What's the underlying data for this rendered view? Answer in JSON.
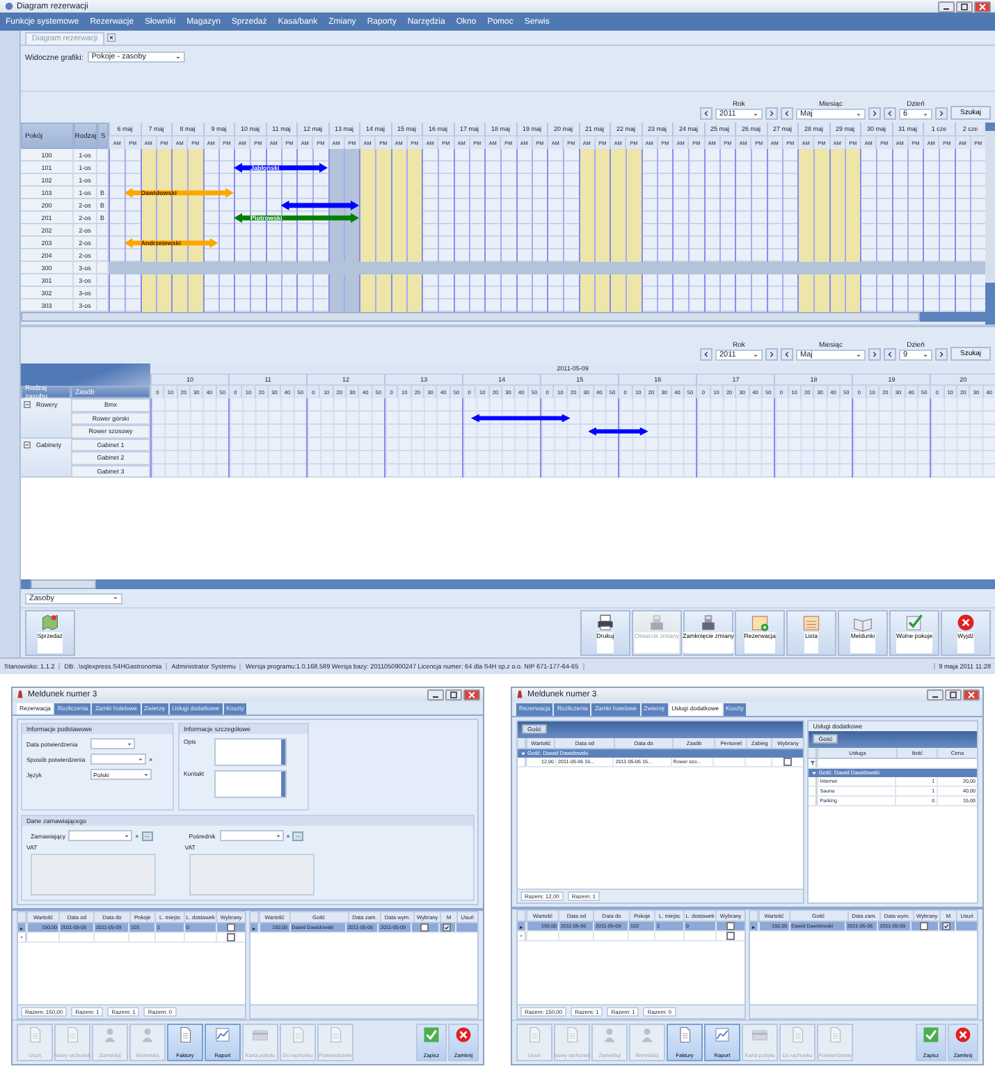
{
  "window": {
    "title": "Diagram rezerwacji"
  },
  "menu": [
    "Funkcje systemowe",
    "Rezerwacje",
    "Słowniki",
    "Magazyn",
    "Sprzedaż",
    "Kasa/bank",
    "Zmiany",
    "Raporty",
    "Narzędzia",
    "Okno",
    "Pomoc",
    "Serwis"
  ],
  "doc_tab": {
    "label": "Diagram rezerwacji",
    "selected": true
  },
  "visible": {
    "label": "Widoczne grafiki:",
    "value": "Pokoje - zasoby"
  },
  "nav_top": {
    "year_label": "Rok",
    "year": "2011",
    "month_label": "Miesiąc",
    "month": "Maj",
    "day_label": "Dzień",
    "day": "6",
    "search": "Szukaj"
  },
  "room_grid": {
    "columns": [
      "Pokój",
      "Rodzaj",
      "S"
    ],
    "days": [
      {
        "label": "6 maj",
        "halves": [
          "AM",
          "PM"
        ],
        "weekend": false,
        "today": false
      },
      {
        "label": "7 maj",
        "halves": [
          "AM",
          "PM"
        ],
        "weekend": true,
        "today": false
      },
      {
        "label": "8 maj",
        "halves": [
          "AM",
          "PM"
        ],
        "weekend": true,
        "today": false
      },
      {
        "label": "9 maj",
        "halves": [
          "AM",
          "PM"
        ],
        "weekend": false,
        "today": false
      },
      {
        "label": "10 maj",
        "halves": [
          "AM",
          "PM"
        ],
        "weekend": false,
        "today": false
      },
      {
        "label": "11 maj",
        "halves": [
          "AM",
          "PM"
        ],
        "weekend": false,
        "today": false
      },
      {
        "label": "12 maj",
        "halves": [
          "AM",
          "PM"
        ],
        "weekend": false,
        "today": false
      },
      {
        "label": "13 maj",
        "halves": [
          "AM",
          "PM"
        ],
        "weekend": false,
        "today": true
      },
      {
        "label": "14 maj",
        "halves": [
          "AM",
          "PM"
        ],
        "weekend": true,
        "today": false
      },
      {
        "label": "15 maj",
        "halves": [
          "AM",
          "PM"
        ],
        "weekend": true,
        "today": false
      },
      {
        "label": "16 maj",
        "halves": [
          "AM",
          "PM"
        ],
        "weekend": false,
        "today": false
      },
      {
        "label": "17 maj",
        "halves": [
          "AM",
          "PM"
        ],
        "weekend": false,
        "today": false
      },
      {
        "label": "18 maj",
        "halves": [
          "AM",
          "PM"
        ],
        "weekend": false,
        "today": false
      },
      {
        "label": "19 maj",
        "halves": [
          "AM",
          "PM"
        ],
        "weekend": false,
        "today": false
      },
      {
        "label": "20 maj",
        "halves": [
          "AM",
          "PM"
        ],
        "weekend": false,
        "today": false
      },
      {
        "label": "21 maj",
        "halves": [
          "AM",
          "PM"
        ],
        "weekend": true,
        "today": false
      },
      {
        "label": "22 maj",
        "halves": [
          "AM",
          "PM"
        ],
        "weekend": true,
        "today": false
      },
      {
        "label": "23 maj",
        "halves": [
          "AM",
          "PM"
        ],
        "weekend": false,
        "today": false
      },
      {
        "label": "24 maj",
        "halves": [
          "AM",
          "PM"
        ],
        "weekend": false,
        "today": false
      },
      {
        "label": "25 maj",
        "halves": [
          "AM",
          "PM"
        ],
        "weekend": false,
        "today": false
      },
      {
        "label": "26 maj",
        "halves": [
          "AM",
          "PM"
        ],
        "weekend": false,
        "today": false
      },
      {
        "label": "27 maj",
        "halves": [
          "AM",
          "PM"
        ],
        "weekend": false,
        "today": false
      },
      {
        "label": "28 maj",
        "halves": [
          "AM",
          "PM"
        ],
        "weekend": true,
        "today": false
      },
      {
        "label": "29 maj",
        "halves": [
          "AM",
          "PM"
        ],
        "weekend": true,
        "today": false
      },
      {
        "label": "30 maj",
        "halves": [
          "AM",
          "PM"
        ],
        "weekend": false,
        "today": false
      },
      {
        "label": "31 maj",
        "halves": [
          "AM",
          "PM"
        ],
        "weekend": false,
        "today": false
      },
      {
        "label": "1 cze",
        "halves": [
          "AM",
          "PM"
        ],
        "weekend": false,
        "today": false
      },
      {
        "label": "2 cze",
        "halves": [
          "AM",
          "PM"
        ],
        "weekend": false,
        "today": false
      }
    ],
    "rooms": [
      {
        "number": "100",
        "type": "1-os",
        "selected": false
      },
      {
        "number": "101",
        "type": "1-os",
        "selected": false,
        "booking": {
          "label": "Jabłoński",
          "color": "#0000ff"
        }
      },
      {
        "number": "102",
        "type": "1-os",
        "selected": false
      },
      {
        "number": "103",
        "type": "1-os",
        "s": "B",
        "selected": false,
        "booking": {
          "label": "Dawidowski",
          "color": "#ffa500"
        }
      },
      {
        "number": "200",
        "type": "2-os",
        "s": "B",
        "selected": false,
        "booking": {
          "color": "#0000ff"
        }
      },
      {
        "number": "201",
        "type": "2-os",
        "s": "B",
        "selected": false,
        "booking": {
          "label": "Piotrowski",
          "color": "#008000"
        }
      },
      {
        "number": "202",
        "type": "2-os",
        "selected": false
      },
      {
        "number": "203",
        "type": "2-os",
        "selected": false,
        "booking": {
          "label": "Andrzejewski",
          "color": "#ffa500"
        }
      },
      {
        "number": "204",
        "type": "2-os",
        "selected": false
      },
      {
        "number": "300",
        "type": "3-os",
        "selected": true
      },
      {
        "number": "301",
        "type": "3-os",
        "selected": false
      },
      {
        "number": "302",
        "type": "3-os",
        "selected": false
      },
      {
        "number": "303",
        "type": "3-os",
        "selected": false
      }
    ]
  },
  "nav_bottom": {
    "year_label": "Rok",
    "year": "2011",
    "month_label": "Miesiąc",
    "month": "Maj",
    "day_label": "Dzień",
    "day": "9",
    "search": "Szukaj"
  },
  "resource_grid": {
    "date": "2011-05-09",
    "columns": [
      "Rodzaj zasobu",
      "Zasób"
    ],
    "hours": [
      {
        "label": "10",
        "minutes": [
          "0",
          "10",
          "20",
          "30",
          "40",
          "50"
        ]
      },
      {
        "label": "11",
        "minutes": [
          "0",
          "10",
          "20",
          "30",
          "40",
          "50"
        ]
      },
      {
        "label": "12",
        "minutes": [
          "0",
          "10",
          "20",
          "30",
          "40",
          "50"
        ]
      },
      {
        "label": "13",
        "minutes": [
          "0",
          "10",
          "20",
          "30",
          "40",
          "50"
        ]
      },
      {
        "label": "14",
        "minutes": [
          "0",
          "10",
          "20",
          "30",
          "40",
          "50"
        ]
      },
      {
        "label": "15",
        "minutes": [
          "0",
          "10",
          "20",
          "30",
          "40",
          "50"
        ]
      },
      {
        "label": "16",
        "minutes": [
          "0",
          "10",
          "20",
          "30",
          "40",
          "50"
        ]
      },
      {
        "label": "17",
        "minutes": [
          "0",
          "10",
          "20",
          "30",
          "40",
          "50"
        ]
      },
      {
        "label": "18",
        "minutes": [
          "0",
          "10",
          "20",
          "30",
          "40",
          "50"
        ]
      },
      {
        "label": "19",
        "minutes": [
          "0",
          "10",
          "20",
          "30",
          "40",
          "50"
        ]
      },
      {
        "label": "20",
        "minutes": [
          "0",
          "10",
          "20",
          "30",
          "40"
        ]
      }
    ],
    "groups": [
      {
        "name": "Rowery",
        "expanded": true,
        "items": [
          {
            "name": "Bmx"
          },
          {
            "name": "Rower górski",
            "booking": {
              "color": "#0000ff"
            }
          },
          {
            "name": "Rower szosowy",
            "booking": {
              "color": "#0000ff"
            }
          }
        ]
      },
      {
        "name": "Gabinety",
        "expanded": true,
        "items": [
          {
            "name": "Gabinet 1"
          },
          {
            "name": "Gabinet 2"
          },
          {
            "name": "Gabinet 3"
          }
        ]
      }
    ]
  },
  "resource_select": "Zasoby",
  "toolbar": {
    "left": [
      {
        "label": "Sprzedaż",
        "kind": "sale",
        "disabled": false
      }
    ],
    "right": [
      {
        "label": "Drukuj",
        "kind": "print",
        "disabled": false
      },
      {
        "label": "Otwarcie zmiany",
        "kind": "open",
        "disabled": true
      },
      {
        "label": "Zamknięcie zmiany",
        "kind": "close-shift",
        "disabled": false
      },
      {
        "label": "Rezerwacja",
        "kind": "add",
        "disabled": false
      },
      {
        "label": "Lista",
        "kind": "list",
        "disabled": false
      },
      {
        "label": "Meldunki",
        "kind": "book",
        "disabled": false
      },
      {
        "label": "Wolne pokoje",
        "kind": "check",
        "disabled": false
      },
      {
        "label": "Wyjdź",
        "kind": "exit",
        "disabled": false
      }
    ]
  },
  "status_bar": {
    "segments": [
      "Stanowisko: 1.1.2",
      "DB: .\\sqlexpress.S4HGastronomia",
      "Administrator Systemu",
      "Wersja programu:1.0.168.589 Wersja bazy: 2011050900247 Licencja numer: 64 dla S4H sp.z o.o. NIP 671-177-64-65"
    ],
    "clock": "9 maja 2011 11:28"
  },
  "dialogs": [
    {
      "kind": "reservation",
      "title": "Meldunek numer 3",
      "tabs": [
        {
          "label": "Rezerwacja",
          "selected": true
        },
        {
          "label": "Rozliczenia",
          "selected": false
        },
        {
          "label": "Zamki hotelowe",
          "selected": false
        },
        {
          "label": "Zwierzę",
          "selected": false
        },
        {
          "label": "Usługi dodatkowe",
          "selected": false
        },
        {
          "label": "Koszty",
          "selected": false
        }
      ],
      "basic": {
        "title": "Informacje podstawowe",
        "fields": [
          {
            "label": "Data potwierdzenia",
            "kind": "combo"
          },
          {
            "label": "Sposób potwierdzenia",
            "kind": "combo-clear",
            "clear": "×"
          },
          {
            "label": "Język",
            "kind": "combo",
            "value": "Polski"
          }
        ]
      },
      "details": {
        "title": "Informacje szczegółowe",
        "fields": [
          {
            "label": "Opis"
          },
          {
            "label": "Kontakt"
          }
        ]
      },
      "orderer": {
        "title": "Dane zamawiającego",
        "parties": [
          {
            "label": "Zamawiający",
            "clear": "×",
            "browse": "...",
            "vat": "VAT"
          },
          {
            "label": "Pośrednik",
            "clear": "×",
            "browse": "...",
            "vat": "VAT"
          }
        ]
      },
      "stays": {
        "columns": [
          "Wartość",
          "Data od",
          "Data do",
          "Pokoje",
          "L. miejsc",
          "L. dostawek",
          "Wybrany"
        ],
        "rows": [
          {
            "kind": "data",
            "marker": "▸",
            "selected": true,
            "cells": [
              {
                "kind": "text",
                "text": "150,00"
              },
              {
                "kind": "text",
                "text": "2011-05-06"
              },
              {
                "kind": "text",
                "text": "2011-05-09"
              },
              {
                "kind": "text",
                "text": "103"
              },
              {
                "kind": "text",
                "text": "1"
              },
              {
                "kind": "text",
                "text": "0"
              },
              {
                "kind": "check",
                "checked": false
              }
            ]
          },
          {
            "kind": "data",
            "marker": "*",
            "selected": false,
            "cells": [
              {
                "kind": "empty"
              },
              {
                "kind": "empty"
              },
              {
                "kind": "empty"
              },
              {
                "kind": "empty"
              },
              {
                "kind": "empty"
              },
              {
                "kind": "empty"
              },
              {
                "kind": "check",
                "checked": false
              }
            ]
          }
        ],
        "totals": [
          "Razem: 150,00",
          "Razem: 1",
          "Razem: 1",
          "Razem: 0"
        ]
      },
      "guests": {
        "columns": [
          "Wartość",
          "Gość",
          "Data zam.",
          "Data wym.",
          "Wybrany",
          "M",
          "Usuń"
        ],
        "rows": [
          {
            "kind": "data",
            "marker": "▸",
            "selected": true,
            "cells": [
              {
                "kind": "text",
                "text": "150,00"
              },
              {
                "kind": "text",
                "text": "Dawid Dawidowski"
              },
              {
                "kind": "text",
                "text": "2011-05-06"
              },
              {
                "kind": "text",
                "text": "2011-05-09"
              },
              {
                "kind": "check",
                "checked": false
              },
              {
                "kind": "check",
                "checked": true
              },
              {
                "kind": "empty"
              }
            ]
          }
        ]
      },
      "buttons": [
        {
          "label": "Usuń",
          "kind": "doc",
          "disabled": true
        },
        {
          "label": "Nowy rachunek",
          "kind": "doc",
          "disabled": true
        },
        {
          "label": "Zamelduj",
          "kind": "person",
          "disabled": true
        },
        {
          "label": "Wymelduj",
          "kind": "person",
          "disabled": true
        },
        {
          "label": "Faktury",
          "kind": "doc",
          "disabled": false
        },
        {
          "label": "Raport",
          "kind": "chart",
          "disabled": false
        },
        {
          "label": "Karta pobytu",
          "kind": "card",
          "disabled": true
        },
        {
          "label": "Do rachunku",
          "kind": "doc",
          "disabled": true
        },
        {
          "label": "Potwierdzenie",
          "kind": "doc",
          "disabled": true
        }
      ],
      "actions": [
        {
          "label": "Zapisz",
          "kind": "check"
        },
        {
          "label": "Zamknij",
          "kind": "exit"
        }
      ]
    },
    {
      "kind": "services",
      "title": "Meldunek numer 3",
      "tabs": [
        {
          "label": "Rezerwacja",
          "selected": false
        },
        {
          "label": "Rozliczenia",
          "selected": false
        },
        {
          "label": "Zamki hotelowe",
          "selected": false
        },
        {
          "label": "Zwierzę",
          "selected": false
        },
        {
          "label": "Usługi dodatkowe",
          "selected": true
        },
        {
          "label": "Koszty",
          "selected": false
        }
      ],
      "left_panel": {
        "chip": "Gość",
        "table": {
          "columns": [
            "Wartość",
            "Data od",
            "Data do",
            "Zasób",
            "Personel",
            "Zabieg",
            "Wybrany"
          ],
          "rows": [
            {
              "kind": "group",
              "text": "Gość: Dawid Dawidowski",
              "expanded": true
            },
            {
              "kind": "data",
              "selected": false,
              "cells": [
                {
                  "kind": "text",
                  "text": "12,00"
                },
                {
                  "kind": "text",
                  "text": "2011-05-06 16..."
                },
                {
                  "kind": "text",
                  "text": "2011-05-06 16..."
                },
                {
                  "kind": "text",
                  "text": "Rower szo..."
                },
                {
                  "kind": "empty"
                },
                {
                  "kind": "empty"
                },
                {
                  "kind": "check",
                  "checked": false
                }
              ]
            }
          ],
          "totals": [
            "Razem: 12,00",
            "Razem: 1"
          ]
        }
      },
      "right_panel": {
        "title": "Usługi dodatkowe",
        "chip": "Gość",
        "table": {
          "columns": [
            "Usługa",
            "Ilość",
            "Cena"
          ],
          "rows": [
            {
              "kind": "filter"
            },
            {
              "kind": "group",
              "text": "Gość: Dawid Dawidowski",
              "expanded": true
            },
            {
              "kind": "data",
              "selected": false,
              "cells": [
                {
                  "kind": "text",
                  "text": "Internet"
                },
                {
                  "kind": "num",
                  "text": "1"
                },
                {
                  "kind": "num",
                  "text": "20,00"
                }
              ]
            },
            {
              "kind": "data",
              "selected": false,
              "cells": [
                {
                  "kind": "text",
                  "text": "Sauna"
                },
                {
                  "kind": "num",
                  "text": "1"
                },
                {
                  "kind": "num",
                  "text": "40,00"
                }
              ]
            },
            {
              "kind": "data",
              "selected": false,
              "cells": [
                {
                  "kind": "text",
                  "text": "Parking"
                },
                {
                  "kind": "num",
                  "text": "0"
                },
                {
                  "kind": "num",
                  "text": "15,00"
                }
              ]
            }
          ]
        }
      },
      "stays": {
        "columns": [
          "Wartość",
          "Data od",
          "Data do",
          "Pokoje",
          "L. miejsc",
          "L. dostawek",
          "Wybrany"
        ],
        "rows": [
          {
            "kind": "data",
            "marker": "▸",
            "selected": true,
            "cells": [
              {
                "kind": "text",
                "text": "150,00"
              },
              {
                "kind": "text",
                "text": "2011-05-06"
              },
              {
                "kind": "text",
                "text": "2011-05-09"
              },
              {
                "kind": "text",
                "text": "103"
              },
              {
                "kind": "text",
                "text": "1"
              },
              {
                "kind": "text",
                "text": "0"
              },
              {
                "kind": "check",
                "checked": false
              }
            ]
          },
          {
            "kind": "data",
            "marker": "*",
            "selected": false,
            "cells": [
              {
                "kind": "empty"
              },
              {
                "kind": "empty"
              },
              {
                "kind": "empty"
              },
              {
                "kind": "empty"
              },
              {
                "kind": "empty"
              },
              {
                "kind": "empty"
              },
              {
                "kind": "check",
                "checked": false
              }
            ]
          }
        ],
        "totals": [
          "Razem: 150,00",
          "Razem: 1",
          "Razem: 1",
          "Razem: 0"
        ]
      },
      "guests": {
        "columns": [
          "Wartość",
          "Gość",
          "Data zam.",
          "Data wym.",
          "Wybrany",
          "M",
          "Usuń"
        ],
        "rows": [
          {
            "kind": "data",
            "marker": "▸",
            "selected": true,
            "cells": [
              {
                "kind": "text",
                "text": "150,00"
              },
              {
                "kind": "text",
                "text": "Dawid Dawidowski"
              },
              {
                "kind": "text",
                "text": "2011-05-06"
              },
              {
                "kind": "text",
                "text": "2011-05-09"
              },
              {
                "kind": "check",
                "checked": false
              },
              {
                "kind": "check",
                "checked": true
              },
              {
                "kind": "empty"
              }
            ]
          }
        ]
      },
      "buttons": [
        {
          "label": "Usuń",
          "kind": "doc",
          "disabled": true
        },
        {
          "label": "Nowy rachunek",
          "kind": "doc",
          "disabled": true
        },
        {
          "label": "Zamelduj",
          "kind": "person",
          "disabled": true
        },
        {
          "label": "Wymelduj",
          "kind": "person",
          "disabled": true
        },
        {
          "label": "Faktury",
          "kind": "doc",
          "disabled": false
        },
        {
          "label": "Raport",
          "kind": "chart",
          "disabled": false
        },
        {
          "label": "Karta pobytu",
          "kind": "card",
          "disabled": true
        },
        {
          "label": "Do rachunku",
          "kind": "doc",
          "disabled": true
        },
        {
          "label": "Potwierdzenie",
          "kind": "doc",
          "disabled": true
        }
      ],
      "actions": [
        {
          "label": "Zapisz",
          "kind": "check"
        },
        {
          "label": "Zamknij",
          "kind": "exit"
        }
      ]
    }
  ]
}
